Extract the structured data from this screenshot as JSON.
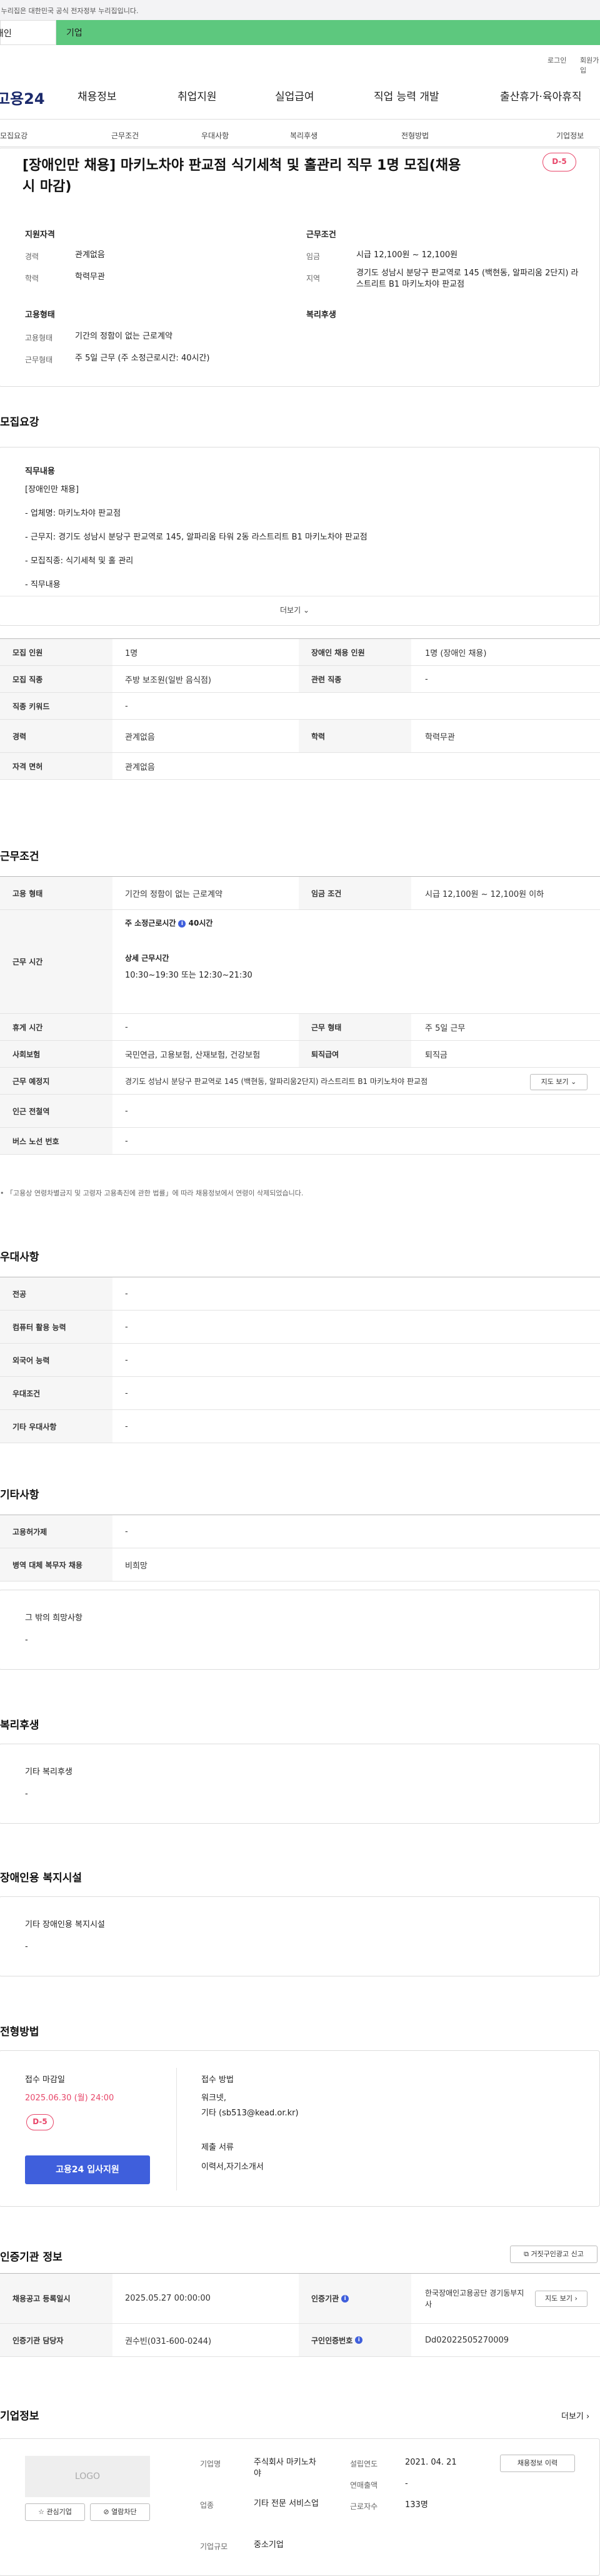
{
  "gov_notice": "이 누리집은 대한민국 공식 전자정부 누리집입니다.",
  "top_tabs": {
    "personal": "개인",
    "company": "기업"
  },
  "util": {
    "login": "로그인",
    "join": "회원가입"
  },
  "logo": "고용24",
  "gnb": [
    "채용정보",
    "취업지원",
    "실업급여",
    "직업 능력 개발",
    "출산휴가·육아휴직"
  ],
  "sub_nav": [
    "모집요강",
    "근무조건",
    "우대사항",
    "복리후생",
    "전형방법",
    "기업정보"
  ],
  "job": {
    "title": "[장애인만 채용] 마키노차야 판교점 식기세척 및 홀관리 직무 1명 모집(채용 시 마감)",
    "dday": "D-5",
    "qual_title": "지원자격",
    "career_label": "경력",
    "career": "관계없음",
    "edu_label": "학력",
    "edu": "학력무관",
    "cond_title": "근무조건",
    "wage_label": "임금",
    "wage": "시급 12,100원 ~ 12,100원",
    "region_label": "지역",
    "region": "경기도 성남시 분당구 판교역로 145 (백현동, 알파리움 2단지) 라스트리트 B1 마키노차야 판교점",
    "emp_title": "고용형태",
    "emptype_label": "고용형태",
    "emptype": "기간의 정함이 없는 근로계약",
    "worktype_label": "근무형태",
    "worktype": "주 5일 근무 (주 소정근로시간: 40시간)",
    "welfare_title": "복리후생"
  },
  "recruit": {
    "section": "모집요강",
    "duty_title": "직무내용",
    "lines": [
      "[장애인만 채용]",
      "- 업체명: 마키노차야 판교점",
      "- 근무지: 경기도 성남시 분당구 판교역로 145, 알파리움 타워 2동 라스트리트 B1 마키노차야 판교점",
      "- 모집직종: 식기세척 및 홀 관리",
      "- 직무내용"
    ],
    "more": "더보기",
    "rows": [
      [
        "모집 인원",
        "1명",
        "장애인 채용 인원",
        "1명 (장애인 채용)"
      ],
      [
        "모집 직종",
        "주방 보조원(일반 음식점)",
        "관련 직종",
        "-"
      ],
      [
        "직종 키워드",
        "-",
        "",
        ""
      ],
      [
        "경력",
        "관계없음",
        "학력",
        "학력무관"
      ],
      [
        "자격 면허",
        "관계없음",
        "",
        ""
      ]
    ]
  },
  "work": {
    "section": "근무조건",
    "emp_l": "고용 형태",
    "emp_v": "기간의 정함이 없는 근로계약",
    "wage_l": "임금 조건",
    "wage_v": "시급 12,100원 ~ 12,100원 이하",
    "time_l": "근무 시간",
    "weekly": "주 소정근로시간",
    "weekly_v": "40시간",
    "detail_t": "상세 근무시간",
    "detail_v": "10:30~19:30 또는 12:30~21:30",
    "rest_l": "휴게 시간",
    "rest_v": "-",
    "wtype_l": "근무 형태",
    "wtype_v": "주 5일 근무",
    "ins_l": "사회보험",
    "ins_v": "국민연금, 고용보험, 산재보험, 건강보험",
    "ret_l": "퇴직급여",
    "ret_v": "퇴직금",
    "place_l": "근무 예정지",
    "place_v": "경기도 성남시 분당구 판교역로 145 (백현동, 알파리움2단지) 라스트리트 B1 마키노차야 판교점",
    "map_btn": "지도 보기",
    "sub_l": "인근 전철역",
    "sub_v": "-",
    "bus_l": "버스 노선 번호",
    "bus_v": "-",
    "note": "「고용상 연령차별금지 및 고령자 고용촉진에 관한 법률」에 따라 채용정보에서 연령이 삭제되었습니다."
  },
  "pref": {
    "section": "우대사항",
    "rows": [
      [
        "전공",
        "-"
      ],
      [
        "컴퓨터 활용 능력",
        "-"
      ],
      [
        "외국어 능력",
        "-"
      ],
      [
        "우대조건",
        "-"
      ],
      [
        "기타 우대사항",
        "-"
      ]
    ]
  },
  "etc": {
    "section": "기타사항",
    "rows": [
      [
        "고용허가제",
        "-"
      ],
      [
        "병역 대체 복무자 채용",
        "비희망"
      ]
    ],
    "hope_t": "그 밖의 희망사항",
    "hope_v": "-"
  },
  "welfare": {
    "section": "복리후생",
    "t": "기타 복리후생",
    "v": "-"
  },
  "facility": {
    "section": "장애인용 복지시설",
    "t": "기타 장애인용 복지시설",
    "v": "-"
  },
  "process": {
    "section": "전형방법",
    "deadline_t": "접수 마감일",
    "deadline_v": "2025.06.30 (월) 24:00",
    "dday": "D-5",
    "apply_btn": "고용24 입사지원",
    "method_t": "접수 방법",
    "method_v1": "워크넷,",
    "method_v2": "기타 (sb513@kead.or.kr)",
    "docs_t": "제출 서류",
    "docs_v": "이력서,자기소개서"
  },
  "cert": {
    "section": "인증기관 정보",
    "report_btn": "거짓구인광고 신고",
    "reg_l": "채용공고 등록일시",
    "reg_v": "2025.05.27 00:00:00",
    "org_l": "인증기관",
    "org_v": "한국장애인고용공단 경기동부지사",
    "map_btn": "지도 보기",
    "mgr_l": "인증기관 담당자",
    "mgr_v": "권수빈(031-600-0244)",
    "id_l": "구인인증번호",
    "id_v": "Dd02022505270009"
  },
  "company": {
    "section": "기업정보",
    "more": "더보기",
    "logo": "LOGO",
    "fav": "관심기업",
    "block": "열람차단",
    "name_l": "기업명",
    "name_v": "주식회사 마키노차야",
    "ind_l": "업종",
    "ind_v": "기타 전문 서비스업",
    "size_l": "기업규모",
    "size_v": "중소기업",
    "est_l": "설립연도",
    "est_v": "2021. 04. 21",
    "sales_l": "연매출액",
    "sales_v": "-",
    "emp_l": "근로자수",
    "emp_v": "133명",
    "jobs_btn": "채용정보 이력"
  }
}
